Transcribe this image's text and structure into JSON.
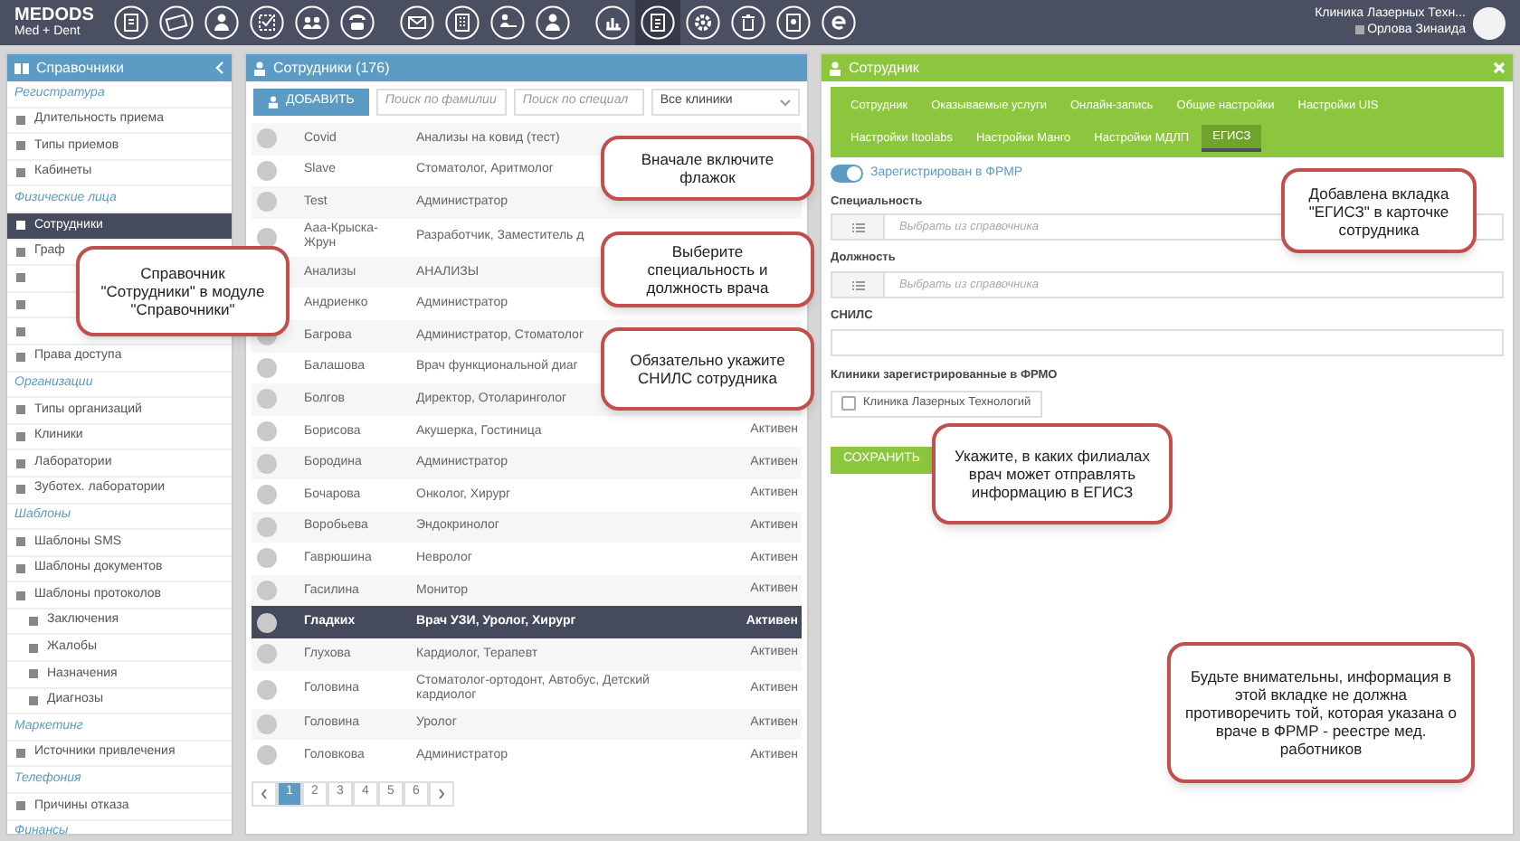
{
  "app": {
    "brand": "MEDODS",
    "subtitle": "Med + Dent"
  },
  "toolbar": [
    {
      "selected": false
    },
    {
      "selected": false
    },
    {
      "selected": false
    },
    {
      "selected": false
    },
    {
      "selected": false
    },
    {
      "selected": false
    },
    {
      "selected": false
    },
    {
      "selected": false
    },
    {
      "selected": false
    },
    {
      "selected": false
    },
    {
      "selected": false
    },
    {
      "selected": true
    },
    {
      "selected": false
    },
    {
      "selected": false
    },
    {
      "selected": false
    },
    {
      "selected": false
    }
  ],
  "user": {
    "clinic": "Клиника Лазерных Техн...",
    "name": "Орлова Зинаида"
  },
  "sidebar": {
    "title": "Справочники",
    "items": [
      {
        "kind": "section",
        "label": "Регистратура"
      },
      {
        "kind": "item",
        "label": "Длительность приема",
        "selected": false
      },
      {
        "kind": "item",
        "label": "Типы приемов",
        "selected": false
      },
      {
        "kind": "item",
        "label": "Кабинеты",
        "selected": false
      },
      {
        "kind": "section",
        "label": "Физические лица"
      },
      {
        "kind": "item",
        "label": "Сотрудники",
        "selected": true
      },
      {
        "kind": "item",
        "label": "Граф",
        "selected": false
      },
      {
        "kind": "item",
        "selected": false
      },
      {
        "kind": "item",
        "selected": false
      },
      {
        "kind": "item",
        "selected": false
      },
      {
        "kind": "item",
        "label": "Права доступа",
        "selected": false
      },
      {
        "kind": "section",
        "label": "Организации"
      },
      {
        "kind": "item",
        "label": "Типы организаций",
        "selected": false
      },
      {
        "kind": "item",
        "label": "Клиники",
        "selected": false
      },
      {
        "kind": "item",
        "label": "Лаборатории",
        "selected": false
      },
      {
        "kind": "item",
        "label": "Зуботех. лаборатории",
        "selected": false
      },
      {
        "kind": "section",
        "label": "Шаблоны"
      },
      {
        "kind": "item",
        "label": "Шаблоны SMS",
        "selected": false
      },
      {
        "kind": "item",
        "label": "Шаблоны документов",
        "selected": false
      },
      {
        "kind": "item",
        "label": "Шаблоны протоколов",
        "selected": false
      },
      {
        "kind": "subitem",
        "label": "Заключения",
        "selected": false
      },
      {
        "kind": "subitem",
        "label": "Жалобы",
        "selected": false
      },
      {
        "kind": "subitem",
        "label": "Назначения",
        "selected": false
      },
      {
        "kind": "subitem",
        "label": "Диагнозы",
        "selected": false
      },
      {
        "kind": "section",
        "label": "Маркетинг"
      },
      {
        "kind": "item",
        "label": "Источники привлечения",
        "selected": false
      },
      {
        "kind": "section",
        "label": "Телефония"
      },
      {
        "kind": "item",
        "label": "Причины отказа",
        "selected": false
      },
      {
        "kind": "section",
        "label": "Финансы"
      }
    ]
  },
  "employees": {
    "title": "Сотрудники (176)",
    "add_button": "ДОБАВИТЬ",
    "search_surname": {
      "placeholder": "Поиск по фамилии"
    },
    "search_specialty": {
      "placeholder": "Поиск по специал"
    },
    "clinic_select": {
      "value": "Все клиники"
    },
    "rows": [
      {
        "name": "Covid",
        "roles": "Анализы на ковид (тест)",
        "selected": false
      },
      {
        "name": "Slave",
        "roles": "Стоматолог, Аритмолог",
        "selected": false
      },
      {
        "name": "Test",
        "roles": "Администратор",
        "selected": false
      },
      {
        "name": "Ааа-Крыска-Жрун",
        "roles": "Разработчик, Заместитель д",
        "selected": false
      },
      {
        "name": "Анализы",
        "roles": "АНАЛИЗЫ",
        "selected": false
      },
      {
        "name": "Андриенко",
        "roles": "Администратор",
        "selected": false
      },
      {
        "name": "Багрова",
        "roles": "Администратор, Стоматолог",
        "selected": false
      },
      {
        "name": "Балашова",
        "roles": "Врач функциональной диаг",
        "selected": false
      },
      {
        "name": "Болгов",
        "roles": "Директор, Отоларинголог",
        "selected": false
      },
      {
        "name": "Борисова",
        "roles": "Акушерка, Гостиница",
        "status": "Активен",
        "selected": false
      },
      {
        "name": "Бородина",
        "roles": "Администратор",
        "status": "Активен",
        "selected": false
      },
      {
        "name": "Бочарова",
        "roles": "Онколог, Хирург",
        "status": "Активен",
        "selected": false
      },
      {
        "name": "Воробьева",
        "roles": "Эндокринолог",
        "status": "Активен",
        "selected": false
      },
      {
        "name": "Гаврюшина",
        "roles": "Невролог",
        "status": "Активен",
        "selected": false
      },
      {
        "name": "Гасилина",
        "roles": "Монитор",
        "status": "Активен",
        "selected": false
      },
      {
        "name": "Гладких",
        "roles": "Врач УЗИ, Уролог, Хирург",
        "status": "Активен",
        "selected": true
      },
      {
        "name": "Глухова",
        "roles": "Кардиолог, Терапевт",
        "status": "Активен",
        "selected": false
      },
      {
        "name": "Головина",
        "roles": "Стоматолог-ортодонт, Автобус, Детский кардиолог",
        "status": "Активен",
        "selected": false
      },
      {
        "name": "Головина",
        "roles": "Уролог",
        "status": "Активен",
        "selected": false
      },
      {
        "name": "Головкова",
        "roles": "Администратор",
        "status": "Активен",
        "selected": false
      }
    ],
    "pages": [
      {
        "label": "1",
        "selected": true
      },
      {
        "label": "2",
        "selected": false
      },
      {
        "label": "3",
        "selected": false
      },
      {
        "label": "4",
        "selected": false
      },
      {
        "label": "5",
        "selected": false
      },
      {
        "label": "6",
        "selected": false
      }
    ]
  },
  "employee_card": {
    "title": "Сотрудник",
    "tabs": [
      {
        "label": "Сотрудник",
        "selected": false
      },
      {
        "label": "Оказываемые услуги",
        "selected": false
      },
      {
        "label": "Онлайн-запись",
        "selected": false
      },
      {
        "label": "Общие настройки",
        "selected": false
      },
      {
        "label": "Настройки UIS",
        "selected": false
      },
      {
        "label": "Настройки Itoolabs",
        "selected": false
      },
      {
        "label": "Настройки Манго",
        "selected": false
      },
      {
        "label": "Настройки МДЛП",
        "selected": false
      },
      {
        "label": "ЕГИСЗ",
        "selected": true
      }
    ],
    "toggle": {
      "label": "Зарегистрирован в ФРМР",
      "on": true
    },
    "fields": [
      {
        "kind": "picker",
        "label": "Специальность",
        "placeholder": "Выбрать из справочника"
      },
      {
        "kind": "picker",
        "label": "Должность",
        "placeholder": "Выбрать из справочника"
      },
      {
        "kind": "text",
        "label": "СНИЛС"
      }
    ],
    "clinics": {
      "label": "Клиники зарегистрированные в ФРМО",
      "items": [
        {
          "label": "Клиника Лазерных Технологий",
          "checked": false
        }
      ]
    },
    "save_button": "СОХРАНИТЬ"
  },
  "callouts": [
    {
      "text": "Справочник \"Сотрудники\" в модуле \"Справочники\""
    },
    {
      "text": "Вначале включите флажок"
    },
    {
      "text": "Выберите специальность и должность врача"
    },
    {
      "text": "Обязательно укажите СНИЛС сотрудника"
    },
    {
      "text": "Добавлена вкладка \"ЕГИСЗ\" в карточке сотрудника"
    },
    {
      "text": "Укажите, в каких филиалах врач может отправлять информацию в ЕГИСЗ"
    },
    {
      "text": "Будьте внимательны, информация в этой вкладке не должна противоречить той, которая указана о враче в ФРМР - реестре мед. работников"
    }
  ]
}
